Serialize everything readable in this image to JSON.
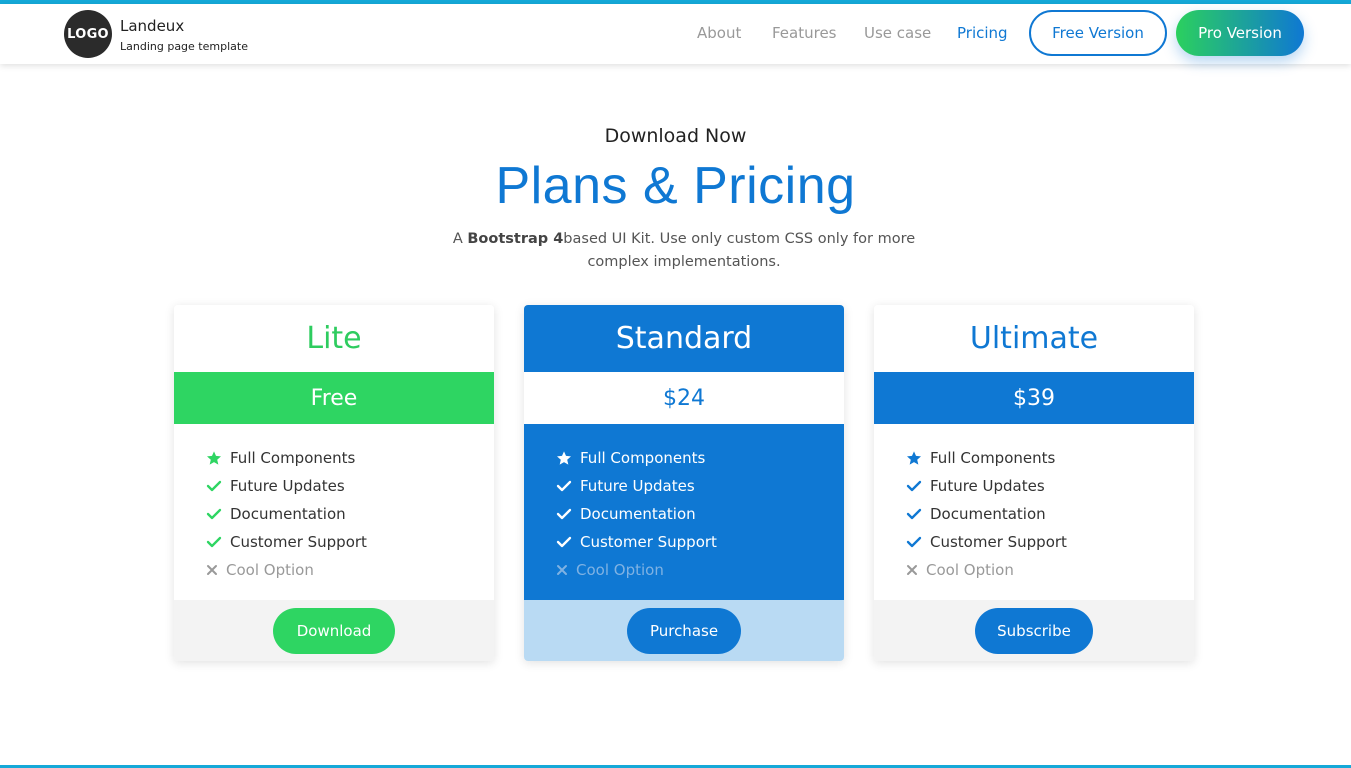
{
  "header": {
    "logo_text": "LOGO",
    "brand_name": "Landeux",
    "brand_tagline": "Landing page template",
    "nav": [
      "About",
      "Features",
      "Use case",
      "Pricing"
    ],
    "free_button": "Free Version",
    "pro_button": "Pro Version"
  },
  "hero": {
    "eyebrow": "Download Now",
    "title": "Plans & Pricing",
    "subtitle_prefix": "A ",
    "subtitle_bold": "Bootstrap 4",
    "subtitle_rest": "based UI Kit. Use only custom CSS only for more complex implementations."
  },
  "plans": [
    {
      "name": "Lite",
      "price": "Free",
      "features": [
        "Full Components",
        "Future Updates",
        "Documentation",
        "Customer Support",
        "Cool Option"
      ],
      "cta": "Download"
    },
    {
      "name": "Standard",
      "price": "$24",
      "features": [
        "Full Components",
        "Future Updates",
        "Documentation",
        "Customer Support",
        "Cool Option"
      ],
      "cta": "Purchase"
    },
    {
      "name": "Ultimate",
      "price": "$39",
      "features": [
        "Full Components",
        "Future Updates",
        "Documentation",
        "Customer Support",
        "Cool Option"
      ],
      "cta": "Subscribe"
    }
  ],
  "colors": {
    "primary": "#0f78d3",
    "green": "#2ed562",
    "accent_bar": "#15a9d8"
  }
}
